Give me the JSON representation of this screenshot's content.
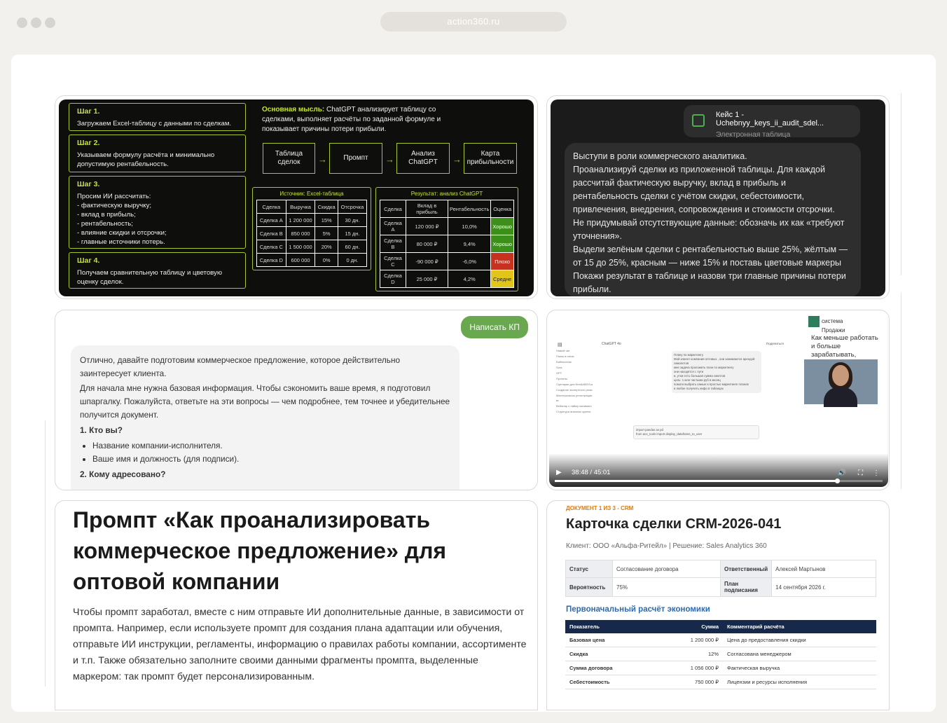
{
  "browser": {
    "url": "action360.ru"
  },
  "steps_card": {
    "steps": [
      {
        "title": "Шаг 1.",
        "text": "Загружаем Excel-таблицу с данными по сделкам."
      },
      {
        "title": "Шаг 2.",
        "text": "Указываем формулу расчёта и минимально допустимую рентабельность."
      },
      {
        "title": "Шаг 3.",
        "text": "Просим ИИ рассчитать:",
        "items": [
          "фактическую выручку;",
          "вклад в прибыль;",
          "рентабельность;",
          "влияние скидки и отсрочки;",
          "главные источники потерь."
        ]
      },
      {
        "title": "Шаг 4.",
        "text": "Получаем сравнительную таблицу и цветовую оценку сделок."
      }
    ],
    "idea_label": "Основная мысль:",
    "idea_text": " ChatGPT анализирует таблицу со сделками, выполняет расчёты по заданной формуле и показывает причины потери прибыли.",
    "flow": [
      "Таблица сделок",
      "Промпт",
      "Анализ ChatGPT",
      "Карта прибыльности"
    ],
    "source_table": {
      "title": "Источник: Excel-таблица",
      "headers": [
        "Сделка",
        "Выручка",
        "Скидка",
        "Отсрочка"
      ],
      "rows": [
        [
          "Сделка A",
          "1 200 000",
          "15%",
          "30 дн."
        ],
        [
          "Сделка B",
          "850 000",
          "5%",
          "15 дн."
        ],
        [
          "Сделка C",
          "1 500 000",
          "20%",
          "60 дн."
        ],
        [
          "Сделка D",
          "600 000",
          "0%",
          "0 дн."
        ]
      ]
    },
    "result_table": {
      "title": "Результат: анализ ChatGPT",
      "headers": [
        "Сделка",
        "Вклад в прибыль",
        "Рентабельность",
        "Оценка"
      ],
      "rows": [
        [
          "Сделка A",
          "120 000 ₽",
          "10,0%",
          "Хорошо"
        ],
        [
          "Сделка B",
          "80 000 ₽",
          "9,4%",
          "Хорошо"
        ],
        [
          "Сделка C",
          "-90 000 ₽",
          "-6,0%",
          "Плохо"
        ],
        [
          "Сделка D",
          "25 000 ₽",
          "4,2%",
          "Средне"
        ]
      ],
      "grade_colors": {
        "Хорошо": "#3b8f1a",
        "Плохо": "#c6321f",
        "Средне": "#e2c519"
      }
    }
  },
  "dark_chat": {
    "file_name": "Кейс 1 - Uchebnyy_keys_ii_audit_sdel...",
    "file_type": "Электронная таблица",
    "message": "Выступи в роли коммерческого аналитика.\nПроанализируй сделки из приложенной таблицы. Для каждой рассчитай фактическую выручку, вклад в прибыль и рентабельность сделки с учётом скидки, себестоимости, привлечения, внедрения, сопровождения и стоимости отсрочки.\nНе придумывай отсутствующие данные: обозначь их как «требуют уточнения».\nВыдели зелёным сделки с рентабельностью выше 25%, жёлтым — от 15 до 25%, красным — ниже 15% и поставь цветовые маркеры\nПокажи результат в таблице и назови три главные причины потери прибыли."
  },
  "light_chat": {
    "button": "Написать КП",
    "p1": "Отлично, давайте подготовим коммерческое предложение, которое действительно заинтересует клиента.",
    "p2": "Для начала мне нужна базовая информация. Чтобы сэкономить ваше время, я подготовил шпаргалку. Пожалуйста, ответьте на эти вопросы — чем подробнее, тем точнее и убедительнее получится документ.",
    "q1": "1. Кто вы?",
    "items": [
      "Название компании-исполнителя.",
      "Ваше имя и должность (для подписи)."
    ],
    "q2": "2. Кому адресовано?"
  },
  "video": {
    "logo_line1": "система",
    "logo_line2": "Продажи",
    "tagline": "Как меньше работать и больше зарабатывать, используя нейросети",
    "time": "38:48 / 45:01",
    "progress": 0.862,
    "app_title": "ChatGPT 4o",
    "share": "Поделиться",
    "sidebar": [
      "Новый чат",
      "Поиск в чатах",
      "Библиотека",
      "Sora",
      "GPT",
      "Проекты",
      "Сценарии для Non&#8203;a",
      "Создание экспертного резю",
      "Мастерклассы регистрации вт",
      "Вебинар о найму нанимать",
      "Структура анализа группы"
    ],
    "prompt_lines": [
      "Плану по маркетингу",
      "Мой клиент компания-оптовых , они занимаются арендой самолетов",
      "мне задача проложить план по маркетингу",
      "они находятся г. пути",
      "и, утки есть большая сумма смоптов",
      "цель: 1 млн чистыми руб в месяц",
      "помоги выбрать самые и простые маркетинге планов",
      "и любое получить инфо в таблицах"
    ],
    "code_lines": [
      "import pandas as pd",
      "from ace_tools import display_dataframe_to_user"
    ]
  },
  "article": {
    "title": "Промпт «Как проанализировать коммерческое предложение» для оптовой компании",
    "body": "Чтобы промпт заработал, вместе с ним отправьте ИИ дополнительные данные, в зависимости от промпта. Например, если используете промпт для создания плана адаптации или обучения, отправьте ИИ инструкции, регламенты, информацию о правилах работы компании, ассортименте и т.п. Также обязательно заполните своими данными фрагменты промпта, выделенные маркером: так промпт будет персонализированным."
  },
  "crm": {
    "tag": "ДОКУМЕНТ 1 ИЗ 3 - CRM",
    "title": "Карточка сделки CRM-2026-041",
    "subtitle": "Клиент: ООО «Альфа-Ритейл»  |  Решение: Sales Analytics 360",
    "info": [
      [
        "Статус",
        "Согласование договора",
        "Ответственный",
        "Алексей Мартынов"
      ],
      [
        "Вероятность",
        "75%",
        "План подписания",
        "14 сентября 2026 г."
      ]
    ],
    "section": "Первоначальный расчёт экономики",
    "headers": [
      "Показатель",
      "Сумма",
      "Комментарий расчёта"
    ],
    "rows": [
      [
        "Базовая цена",
        "1 200 000 ₽",
        "Цена до предоставления скидки"
      ],
      [
        "Скидка",
        "12%",
        "Согласована менеджером"
      ],
      [
        "Сумма договора",
        "1 056 000 ₽",
        "Фактическая выручка"
      ],
      [
        "Себестоимость",
        "750 000 ₽",
        "Лицензии и ресурсы исполнения"
      ]
    ]
  }
}
